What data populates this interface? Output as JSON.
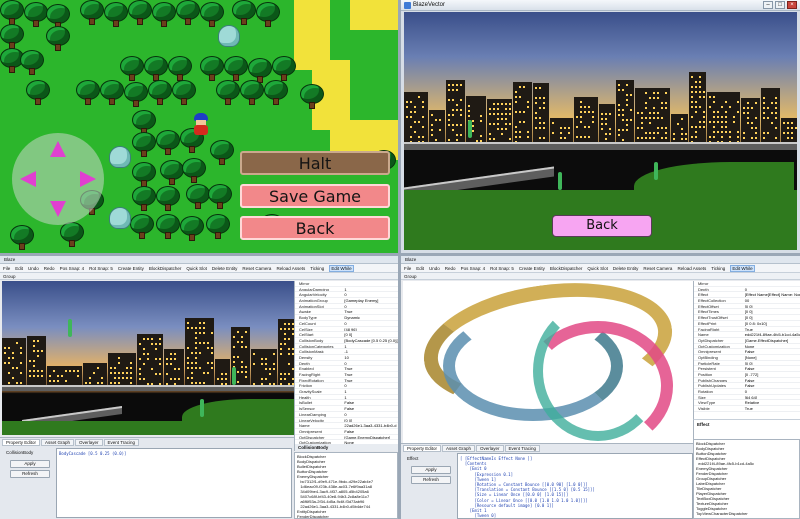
{
  "game": {
    "halt_label": "Halt",
    "save_label": "Save Game",
    "back_label": "Back"
  },
  "blaze": {
    "window_title": "BlazeVector",
    "back_label": "Back"
  },
  "editor1": {
    "title": "Blaze",
    "menu": [
      "File",
      "Edit",
      "Undo",
      "Redo",
      "Pos Snap: 4",
      "Rot Snap: 5",
      "Create Entity",
      "BlockDispatcher",
      "Quick Slot",
      "Delete Entity",
      "Reset Camera",
      "Reload Assets",
      "Ticking",
      "Edit While"
    ],
    "tab": "Group",
    "props": [
      [
        "Mirror",
        ""
      ],
      [
        "AngularDamping",
        "1"
      ],
      [
        "AngularVelocity",
        "0"
      ],
      [
        "AnimationGroup",
        "[Gameplay Enemy]"
      ],
      [
        "AnimationSlot",
        "0"
      ],
      [
        "Awake",
        "True"
      ],
      [
        "BodyType",
        "Dynamic"
      ],
      [
        "CelCount",
        "0"
      ],
      [
        "CelSize",
        "[48 96]"
      ],
      [
        "CelStart",
        "[0 0]"
      ],
      [
        "CollisionBody",
        "[BodyCascade [0.5 0.25 (0.0)]]"
      ],
      [
        "CollisionCategories",
        "1"
      ],
      [
        "CollisionMask",
        "-1"
      ],
      [
        "Density",
        "10"
      ],
      [
        "Depth",
        "0"
      ],
      [
        "Enabled",
        "True"
      ],
      [
        "FacingRight",
        "True"
      ],
      [
        "FixedRotation",
        "True"
      ],
      [
        "Friction",
        "0"
      ],
      [
        "GravityScale",
        "1"
      ],
      [
        "Health",
        "1"
      ],
      [
        "IsBullet",
        "False"
      ],
      [
        "IsSensor",
        "False"
      ],
      [
        "LinearDamping",
        "0"
      ],
      [
        "LinearVelocity",
        "[0 0]"
      ],
      [
        "Name",
        "22ad26e1-3aa3-4331-b4b0-d"
      ],
      [
        "Omnipresent",
        "False"
      ],
      [
        "OptDispatcher",
        "[Game.EnemyDispatcher]"
      ],
      [
        "OptCustomization",
        "None"
      ]
    ],
    "collision_label": "CollisionBody",
    "bottom_tabs": [
      "Property Editor",
      "Asset Graph",
      "Overlayer",
      "Event Tracing"
    ],
    "bottom_heading": "CollisionBody",
    "code": "BodyCascade [0.5 0.25 (0.0)]",
    "apply_label": "Apply",
    "refresh_label": "Refresh",
    "tree": [
      "BlockDispatcher",
      "BodyDispatcher",
      "BulletDispatcher",
      "ButtonDispatcher",
      "EnemyDispatcher",
      "   bc7312f1-d9e9-471e-9bdc-d29e22ab4e7",
      "   1d6eac09-f23b-438e-ac03-7e6f9aa31a8",
      "   34d09be4-3ac9-4f37-a805-d5b4205a6",
      "   5407c68f-bf43-40e8-94b3-2c8a8e11c7",
      "   a6f6f53a-2f34-4d5a-9c6f-f3d73ab96",
      "   22ad26e1-3aa3-4331-b4b0-d5b4de744",
      "EntityDispatcher",
      "FenderDispatcher",
      "GroupDispatcher",
      "LabelDispatcher",
      "PlayerDispatcher"
    ]
  },
  "editor2": {
    "menu": [
      "File",
      "Edit",
      "Undo",
      "Redo",
      "Pos Snap: 4",
      "Rot Snap: 5",
      "Create Entity",
      "BlockDispatcher",
      "Quick Slot",
      "Delete Entity",
      "Reset Camera",
      "Reload Assets",
      "Ticking",
      "Edit While"
    ],
    "tab": "Group",
    "props": [
      [
        "Mirror",
        ""
      ],
      [
        "Depth",
        "0"
      ],
      [
        "Effect",
        "[Effect Name[Effect] Name: None ]"
      ],
      [
        "EffectCollection",
        "00"
      ],
      [
        "EffectOffset",
        "[0 0]"
      ],
      [
        "EffectTimes",
        "[0 0]"
      ],
      [
        "EffectTrustOffset",
        "[0 0]"
      ],
      [
        "EffectPrint",
        "[0 0 8: 0x10]"
      ],
      [
        "FacingRight",
        "True"
      ],
      [
        "Name",
        "edd221f4-89ae-4fc5-b1cd-4a5c"
      ],
      [
        "OptDispatcher",
        "[Game.EffectDispatcher]"
      ],
      [
        "OptCustomization",
        "None"
      ],
      [
        "Omnipresent",
        "False"
      ],
      [
        "OptBinding",
        "[None]"
      ],
      [
        "ParticleRate",
        "[0 0]"
      ],
      [
        "Persistent",
        "False"
      ],
      [
        "Position",
        "[0 -772]"
      ],
      [
        "PublishChanges",
        "False"
      ],
      [
        "PublishUpdates",
        "False"
      ],
      [
        "Rotation",
        "0"
      ],
      [
        "Size",
        "[64 64]"
      ],
      [
        "ViewType",
        "Relative"
      ],
      [
        "Visible",
        "True"
      ]
    ],
    "effect_label": "Effect",
    "bottom_tabs": [
      "Property Editor",
      "Asset Graph",
      "Overlayer",
      "Event Tracing"
    ],
    "bottom_heading": "Effect",
    "code": "[ [EffectNameIs Effect None ]]\n  [Contents\n    [Emit 0\n      [Expression 0.1]\n      [Tween 1]\n      [Rotation = Constant Bounce [[0.0 90] [1.0 0]]]\n      [Translation = Constant Bounce [[1.5 0] [0.5 15]]]\n      [Size = Linear Once [[0.0 0] [1.0 15]]]\n      [Color = Linear Once [[0.0 [1.0 1.0 1.0 1.0]]]]\n      [Resource default image] [0.0 1]]\n    [Emit 1\n      [Tween 0]\n      [Rotation = Linear Once [[0.0 0]]]\n      [Translation = Constant Once [[0 0]]]",
    "apply_label": "Apply",
    "refresh_label": "Refresh",
    "tree": [
      "BlockDispatcher",
      "BodyDispatcher",
      "ButtonDispatcher",
      "EffectDispatcher",
      "  edd221f4-89ae-4fc5-b1cd-4a5c",
      "EnemyDispatcher",
      "FenderDispatcher",
      "GroupDispatcher",
      "LabelDispatcher",
      "TileDispatcher",
      "PlayerDispatcher",
      "TextBoxDispatcher",
      "TextureDispatcher",
      "ToggleDispatcher",
      "TopViewCharacterDispatcher"
    ]
  }
}
